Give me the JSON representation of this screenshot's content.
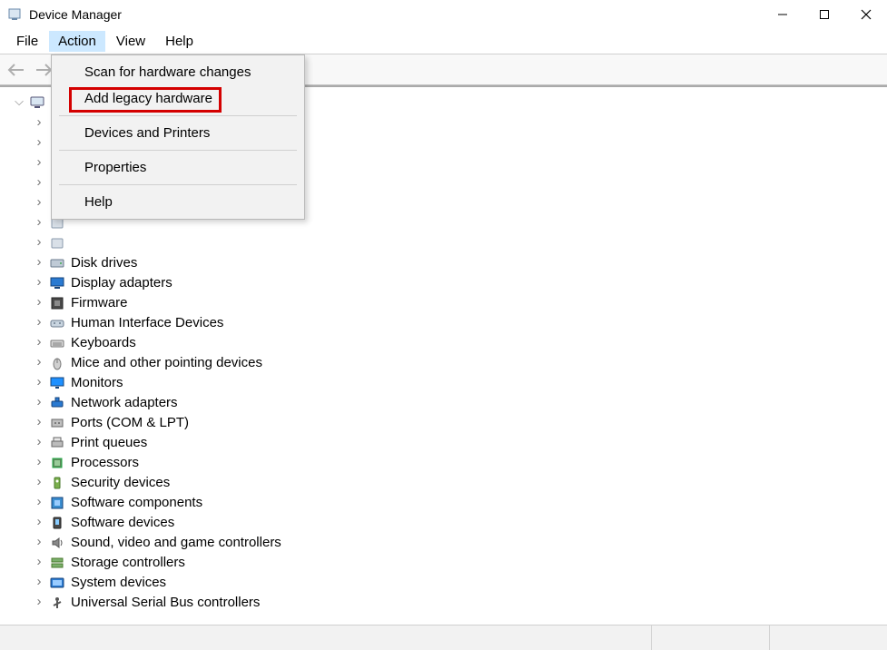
{
  "window": {
    "title": "Device Manager"
  },
  "menubar": {
    "file": "File",
    "action": "Action",
    "view": "View",
    "help": "Help"
  },
  "action_menu": {
    "scan": "Scan for hardware changes",
    "add_legacy": "Add legacy hardware",
    "devices_printers": "Devices and Printers",
    "properties": "Properties",
    "help": "Help"
  },
  "tree": {
    "root": "",
    "nodes": [
      {
        "label": "",
        "icon": "generic"
      },
      {
        "label": "",
        "icon": "generic"
      },
      {
        "label": "",
        "icon": "generic"
      },
      {
        "label": "",
        "icon": "generic"
      },
      {
        "label": "",
        "icon": "generic"
      },
      {
        "label": "",
        "icon": "generic"
      },
      {
        "label": "",
        "icon": "generic"
      },
      {
        "label": "Disk drives",
        "icon": "disk"
      },
      {
        "label": "Display adapters",
        "icon": "display"
      },
      {
        "label": "Firmware",
        "icon": "firmware"
      },
      {
        "label": "Human Interface Devices",
        "icon": "hid"
      },
      {
        "label": "Keyboards",
        "icon": "keyboard"
      },
      {
        "label": "Mice and other pointing devices",
        "icon": "mouse"
      },
      {
        "label": "Monitors",
        "icon": "monitor"
      },
      {
        "label": "Network adapters",
        "icon": "network"
      },
      {
        "label": "Ports (COM & LPT)",
        "icon": "ports"
      },
      {
        "label": "Print queues",
        "icon": "printer"
      },
      {
        "label": "Processors",
        "icon": "cpu"
      },
      {
        "label": "Security devices",
        "icon": "security"
      },
      {
        "label": "Software components",
        "icon": "component"
      },
      {
        "label": "Software devices",
        "icon": "softdev"
      },
      {
        "label": "Sound, video and game controllers",
        "icon": "sound"
      },
      {
        "label": "Storage controllers",
        "icon": "storage"
      },
      {
        "label": "System devices",
        "icon": "system"
      },
      {
        "label": "Universal Serial Bus controllers",
        "icon": "usb"
      }
    ]
  }
}
